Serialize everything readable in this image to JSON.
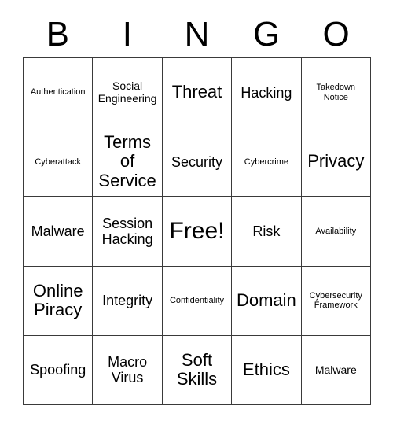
{
  "card": {
    "title_letters": [
      "B",
      "I",
      "N",
      "G",
      "O"
    ],
    "free_space_label": "Free!",
    "grid_size": "5x5",
    "border_color": "#3a3a3a",
    "background_color": "#ffffff",
    "text_color": "#000000"
  },
  "grid": {
    "rows": [
      {
        "cells": [
          {
            "text": "Authentication",
            "size": "xs"
          },
          {
            "text": "Social Engineering",
            "size": "s"
          },
          {
            "text": "Threat",
            "size": "l"
          },
          {
            "text": "Hacking",
            "size": "m"
          },
          {
            "text": "Takedown Notice",
            "size": "xs"
          }
        ]
      },
      {
        "cells": [
          {
            "text": "Cyberattack",
            "size": "xs"
          },
          {
            "text": "Terms of Service",
            "size": "l"
          },
          {
            "text": "Security",
            "size": "m"
          },
          {
            "text": "Cybercrime",
            "size": "xs"
          },
          {
            "text": "Privacy",
            "size": "l"
          }
        ]
      },
      {
        "cells": [
          {
            "text": "Malware",
            "size": "m"
          },
          {
            "text": "Session Hacking",
            "size": "m"
          },
          {
            "text": "Free!",
            "size": "xl"
          },
          {
            "text": "Risk",
            "size": "m"
          },
          {
            "text": "Availability",
            "size": "xs"
          }
        ]
      },
      {
        "cells": [
          {
            "text": "Online Piracy",
            "size": "l"
          },
          {
            "text": "Integrity",
            "size": "m"
          },
          {
            "text": "Confidentiality",
            "size": "xs"
          },
          {
            "text": "Domain",
            "size": "l"
          },
          {
            "text": "Cybersecurity Framework",
            "size": "xs"
          }
        ]
      },
      {
        "cells": [
          {
            "text": "Spoofing",
            "size": "m"
          },
          {
            "text": "Macro Virus",
            "size": "m"
          },
          {
            "text": "Soft Skills",
            "size": "l"
          },
          {
            "text": "Ethics",
            "size": "l"
          },
          {
            "text": "Malware",
            "size": "s"
          }
        ]
      }
    ]
  }
}
